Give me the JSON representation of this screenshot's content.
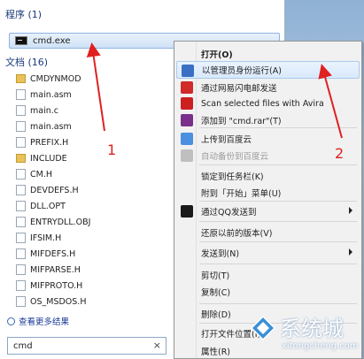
{
  "start_menu": {
    "programs_heading": "程序 (1)",
    "program_item": "cmd.exe",
    "documents_heading": "文档 (16)",
    "documents": [
      {
        "name": "CMDYNMOD",
        "type": "folder"
      },
      {
        "name": "main.asm",
        "type": "file"
      },
      {
        "name": "main.c",
        "type": "file"
      },
      {
        "name": "main.asm",
        "type": "file"
      },
      {
        "name": "PREFIX.H",
        "type": "file"
      },
      {
        "name": "INCLUDE",
        "type": "folder"
      },
      {
        "name": "CM.H",
        "type": "file"
      },
      {
        "name": "DEVDEFS.H",
        "type": "file"
      },
      {
        "name": "DLL.OPT",
        "type": "file"
      },
      {
        "name": "ENTRYDLL.OBJ",
        "type": "file"
      },
      {
        "name": "IFSIM.H",
        "type": "file"
      },
      {
        "name": "MIFDEFS.H",
        "type": "file"
      },
      {
        "name": "MIFPARSE.H",
        "type": "file"
      },
      {
        "name": "MIFPROTO.H",
        "type": "file"
      },
      {
        "name": "OS_MSDOS.H",
        "type": "file"
      }
    ],
    "more_results": "查看更多结果",
    "search_value": "cmd",
    "search_clear": "×"
  },
  "context_menu": {
    "items": [
      {
        "label": "打开(O)",
        "bold": true,
        "icon": null
      },
      {
        "label": "以管理员身份运行(A)",
        "icon": "shield-icon",
        "icon_color": "#3a6fc4",
        "highlighted": true
      },
      {
        "label": "通过网易闪电邮发送",
        "icon": "mail-icon",
        "icon_color": "#d02a2a"
      },
      {
        "label": "Scan selected files with Avira",
        "icon": "avira-icon",
        "icon_color": "#cc1f1f"
      },
      {
        "label": "添加到 \"cmd.rar\"(T)",
        "icon": "winrar-icon",
        "icon_color": "#7a2f8a"
      },
      {
        "label": "上传到百度云",
        "icon": "baidu-cloud-icon",
        "icon_color": "#4a8fe0"
      },
      {
        "label": "自动备份到百度云",
        "icon": "baidu-backup-icon",
        "icon_color": "#bfbfbf",
        "disabled": true
      },
      {
        "label": "锁定到任务栏(K)",
        "icon": null
      },
      {
        "label": "附到「开始」菜单(U)",
        "icon": null
      },
      {
        "label": "通过QQ发送到",
        "icon": "qq-icon",
        "icon_color": "#1a1a1a",
        "submenu": true
      },
      {
        "label": "还原以前的版本(V)",
        "icon": null
      },
      {
        "label": "发送到(N)",
        "icon": null,
        "submenu": true
      },
      {
        "label": "剪切(T)",
        "icon": null
      },
      {
        "label": "复制(C)",
        "icon": null
      },
      {
        "label": "删除(D)",
        "icon": null
      },
      {
        "label": "打开文件位置(I)",
        "icon": null
      },
      {
        "label": "属性(R)",
        "icon": null
      }
    ]
  },
  "annotations": {
    "label_1": "1",
    "label_2": "2",
    "color": "#e02020"
  },
  "watermark": {
    "title": "系统城",
    "url": "xitongcheng.com"
  }
}
